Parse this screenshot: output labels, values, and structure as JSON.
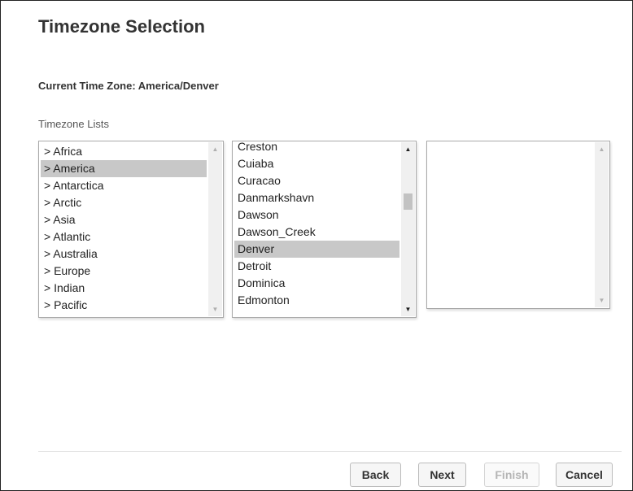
{
  "title": "Timezone Selection",
  "current_timezone_label": "Current Time Zone: America/Denver",
  "lists_label": "Timezone Lists",
  "region_list": {
    "items": [
      "> Africa",
      "> America",
      "> Antarctica",
      "> Arctic",
      "> Asia",
      "> Atlantic",
      "> Australia",
      "> Europe",
      "> Indian",
      "> Pacific"
    ],
    "selected": "> America"
  },
  "city_list": {
    "items": [
      "Creston",
      "Cuiaba",
      "Curacao",
      "Danmarkshavn",
      "Dawson",
      "Dawson_Creek",
      "Denver",
      "Detroit",
      "Dominica",
      "Edmonton"
    ],
    "selected": "Denver"
  },
  "sub_list": {
    "items": []
  },
  "buttons": {
    "back": "Back",
    "next": "Next",
    "finish": "Finish",
    "cancel": "Cancel"
  },
  "icons": {
    "scroll_up": "scroll-up-arrow-icon",
    "scroll_down": "scroll-down-arrow-icon"
  },
  "colors": {
    "selected_row": "#c8c8c8",
    "text": "#333333",
    "disabled_text": "#b5b5b5"
  }
}
